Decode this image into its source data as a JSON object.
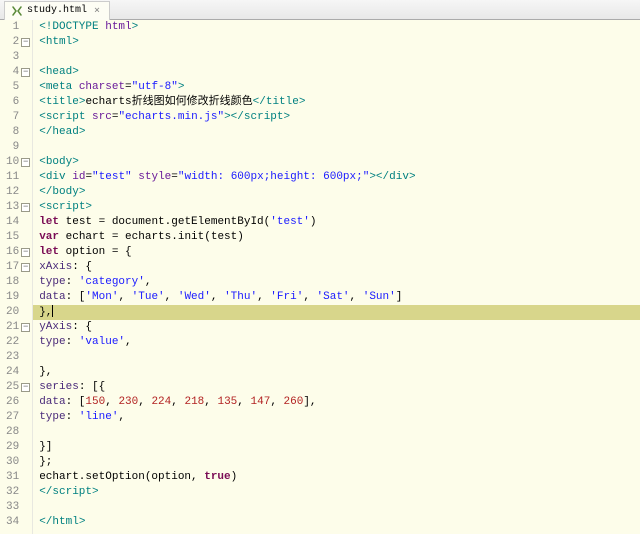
{
  "tab": {
    "filename": "study.html",
    "icon_label": "html",
    "close_glyph": "⨯"
  },
  "fold_glyph": "−",
  "lines": [
    {
      "num": 1,
      "foldable": false,
      "highlighted": false,
      "tokens": [
        [
          "t-punct",
          "<!"
        ],
        [
          "t-tag",
          "DOCTYPE"
        ],
        [
          "t-text",
          " "
        ],
        [
          "t-attr",
          "html"
        ],
        [
          "t-punct",
          ">"
        ]
      ]
    },
    {
      "num": 2,
      "foldable": true,
      "highlighted": false,
      "tokens": [
        [
          "t-punct",
          "<"
        ],
        [
          "t-tag",
          "html"
        ],
        [
          "t-punct",
          ">"
        ]
      ]
    },
    {
      "num": 3,
      "foldable": false,
      "highlighted": false,
      "tokens": []
    },
    {
      "num": 4,
      "foldable": true,
      "highlighted": false,
      "tokens": [
        [
          "t-text",
          "    "
        ],
        [
          "t-punct",
          "<"
        ],
        [
          "t-tag",
          "head"
        ],
        [
          "t-punct",
          ">"
        ]
      ]
    },
    {
      "num": 5,
      "foldable": false,
      "highlighted": false,
      "tokens": [
        [
          "t-text",
          "        "
        ],
        [
          "t-punct",
          "<"
        ],
        [
          "t-tag",
          "meta"
        ],
        [
          "t-text",
          " "
        ],
        [
          "t-attr",
          "charset"
        ],
        [
          "t-op",
          "="
        ],
        [
          "t-string",
          "\"utf-8\""
        ],
        [
          "t-punct",
          ">"
        ]
      ]
    },
    {
      "num": 6,
      "foldable": false,
      "highlighted": false,
      "tokens": [
        [
          "t-text",
          "        "
        ],
        [
          "t-punct",
          "<"
        ],
        [
          "t-tag",
          "title"
        ],
        [
          "t-punct",
          ">"
        ],
        [
          "t-text",
          "echarts折线图如何修改折线颜色"
        ],
        [
          "t-punct",
          "</"
        ],
        [
          "t-tag",
          "title"
        ],
        [
          "t-punct",
          ">"
        ]
      ]
    },
    {
      "num": 7,
      "foldable": false,
      "highlighted": false,
      "tokens": [
        [
          "t-text",
          "        "
        ],
        [
          "t-punct",
          "<"
        ],
        [
          "t-tag",
          "script"
        ],
        [
          "t-text",
          " "
        ],
        [
          "t-attr",
          "src"
        ],
        [
          "t-op",
          "="
        ],
        [
          "t-string",
          "\"echarts.min.js\""
        ],
        [
          "t-punct",
          "></"
        ],
        [
          "t-tag",
          "script"
        ],
        [
          "t-punct",
          ">"
        ]
      ]
    },
    {
      "num": 8,
      "foldable": false,
      "highlighted": false,
      "tokens": [
        [
          "t-text",
          "    "
        ],
        [
          "t-punct",
          "</"
        ],
        [
          "t-tag",
          "head"
        ],
        [
          "t-punct",
          ">"
        ]
      ]
    },
    {
      "num": 9,
      "foldable": false,
      "highlighted": false,
      "tokens": []
    },
    {
      "num": 10,
      "foldable": true,
      "highlighted": false,
      "tokens": [
        [
          "t-text",
          "    "
        ],
        [
          "t-punct",
          "<"
        ],
        [
          "t-tag",
          "body"
        ],
        [
          "t-punct",
          ">"
        ]
      ]
    },
    {
      "num": 11,
      "foldable": false,
      "highlighted": false,
      "tokens": [
        [
          "t-text",
          "        "
        ],
        [
          "t-punct",
          "<"
        ],
        [
          "t-tag",
          "div"
        ],
        [
          "t-text",
          " "
        ],
        [
          "t-attr",
          "id"
        ],
        [
          "t-op",
          "="
        ],
        [
          "t-string",
          "\"test\""
        ],
        [
          "t-text",
          "  "
        ],
        [
          "t-attr",
          "style"
        ],
        [
          "t-op",
          "="
        ],
        [
          "t-string",
          "\"width: 600px;height: 600px;\""
        ],
        [
          "t-punct",
          "></"
        ],
        [
          "t-tag",
          "div"
        ],
        [
          "t-punct",
          ">"
        ]
      ]
    },
    {
      "num": 12,
      "foldable": false,
      "highlighted": false,
      "tokens": [
        [
          "t-text",
          "    "
        ],
        [
          "t-punct",
          "</"
        ],
        [
          "t-tag",
          "body"
        ],
        [
          "t-punct",
          ">"
        ]
      ]
    },
    {
      "num": 13,
      "foldable": true,
      "highlighted": false,
      "tokens": [
        [
          "t-text",
          "    "
        ],
        [
          "t-punct",
          "<"
        ],
        [
          "t-tag",
          "script"
        ],
        [
          "t-punct",
          ">"
        ]
      ]
    },
    {
      "num": 14,
      "foldable": false,
      "highlighted": false,
      "tokens": [
        [
          "t-text",
          "        "
        ],
        [
          "t-keyword",
          "let"
        ],
        [
          "t-text",
          " test "
        ],
        [
          "t-op",
          "="
        ],
        [
          "t-text",
          " document.getElementById("
        ],
        [
          "t-string",
          "'test'"
        ],
        [
          "t-text",
          ")"
        ]
      ]
    },
    {
      "num": 15,
      "foldable": false,
      "highlighted": false,
      "tokens": [
        [
          "t-text",
          "        "
        ],
        [
          "t-keyword",
          "var"
        ],
        [
          "t-text",
          " echart "
        ],
        [
          "t-op",
          "="
        ],
        [
          "t-text",
          " echarts.init(test)"
        ]
      ]
    },
    {
      "num": 16,
      "foldable": true,
      "highlighted": false,
      "tokens": [
        [
          "t-text",
          "        "
        ],
        [
          "t-keyword",
          "let"
        ],
        [
          "t-text",
          " option "
        ],
        [
          "t-op",
          "="
        ],
        [
          "t-text",
          " {"
        ]
      ]
    },
    {
      "num": 17,
      "foldable": true,
      "highlighted": false,
      "tokens": [
        [
          "t-text",
          "            "
        ],
        [
          "t-prop",
          "xAxis"
        ],
        [
          "t-text",
          ": {"
        ]
      ]
    },
    {
      "num": 18,
      "foldable": false,
      "highlighted": false,
      "tokens": [
        [
          "t-text",
          "                "
        ],
        [
          "t-prop",
          "type"
        ],
        [
          "t-text",
          ": "
        ],
        [
          "t-string",
          "'category'"
        ],
        [
          "t-text",
          ","
        ]
      ]
    },
    {
      "num": 19,
      "foldable": false,
      "highlighted": false,
      "tokens": [
        [
          "t-text",
          "                "
        ],
        [
          "t-prop",
          "data"
        ],
        [
          "t-text",
          ": ["
        ],
        [
          "t-string",
          "'Mon'"
        ],
        [
          "t-text",
          ", "
        ],
        [
          "t-string",
          "'Tue'"
        ],
        [
          "t-text",
          ", "
        ],
        [
          "t-string",
          "'Wed'"
        ],
        [
          "t-text",
          ", "
        ],
        [
          "t-string",
          "'Thu'"
        ],
        [
          "t-text",
          ", "
        ],
        [
          "t-string",
          "'Fri'"
        ],
        [
          "t-text",
          ", "
        ],
        [
          "t-string",
          "'Sat'"
        ],
        [
          "t-text",
          ", "
        ],
        [
          "t-string",
          "'Sun'"
        ],
        [
          "t-text",
          "]"
        ]
      ]
    },
    {
      "num": 20,
      "foldable": false,
      "highlighted": true,
      "tokens": [
        [
          "t-text",
          "            },"
        ],
        [
          "cursor",
          ""
        ]
      ]
    },
    {
      "num": 21,
      "foldable": true,
      "highlighted": false,
      "tokens": [
        [
          "t-text",
          "            "
        ],
        [
          "t-prop",
          "yAxis"
        ],
        [
          "t-text",
          ": {"
        ]
      ]
    },
    {
      "num": 22,
      "foldable": false,
      "highlighted": false,
      "tokens": [
        [
          "t-text",
          "                "
        ],
        [
          "t-prop",
          "type"
        ],
        [
          "t-text",
          ": "
        ],
        [
          "t-string",
          "'value'"
        ],
        [
          "t-text",
          ","
        ]
      ]
    },
    {
      "num": 23,
      "foldable": false,
      "highlighted": false,
      "tokens": []
    },
    {
      "num": 24,
      "foldable": false,
      "highlighted": false,
      "tokens": [
        [
          "t-text",
          "            },"
        ]
      ]
    },
    {
      "num": 25,
      "foldable": true,
      "highlighted": false,
      "tokens": [
        [
          "t-text",
          "            "
        ],
        [
          "t-prop",
          "series"
        ],
        [
          "t-text",
          ": [{"
        ]
      ]
    },
    {
      "num": 26,
      "foldable": false,
      "highlighted": false,
      "tokens": [
        [
          "t-text",
          "                "
        ],
        [
          "t-prop",
          "data"
        ],
        [
          "t-text",
          ": ["
        ],
        [
          "t-num",
          "150"
        ],
        [
          "t-text",
          ", "
        ],
        [
          "t-num",
          "230"
        ],
        [
          "t-text",
          ", "
        ],
        [
          "t-num",
          "224"
        ],
        [
          "t-text",
          ", "
        ],
        [
          "t-num",
          "218"
        ],
        [
          "t-text",
          ", "
        ],
        [
          "t-num",
          "135"
        ],
        [
          "t-text",
          ", "
        ],
        [
          "t-num",
          "147"
        ],
        [
          "t-text",
          ", "
        ],
        [
          "t-num",
          "260"
        ],
        [
          "t-text",
          "],"
        ]
      ]
    },
    {
      "num": 27,
      "foldable": false,
      "highlighted": false,
      "tokens": [
        [
          "t-text",
          "                "
        ],
        [
          "t-prop",
          "type"
        ],
        [
          "t-text",
          ": "
        ],
        [
          "t-string",
          "'line'"
        ],
        [
          "t-text",
          ","
        ]
      ]
    },
    {
      "num": 28,
      "foldable": false,
      "highlighted": false,
      "tokens": []
    },
    {
      "num": 29,
      "foldable": false,
      "highlighted": false,
      "tokens": [
        [
          "t-text",
          "            }]"
        ]
      ]
    },
    {
      "num": 30,
      "foldable": false,
      "highlighted": false,
      "tokens": [
        [
          "t-text",
          "        };"
        ]
      ]
    },
    {
      "num": 31,
      "foldable": false,
      "highlighted": false,
      "tokens": [
        [
          "t-text",
          "        echart.setOption(option, "
        ],
        [
          "t-keyword",
          "true"
        ],
        [
          "t-text",
          ")"
        ]
      ]
    },
    {
      "num": 32,
      "foldable": false,
      "highlighted": false,
      "tokens": [
        [
          "t-text",
          "    "
        ],
        [
          "t-punct",
          "</"
        ],
        [
          "t-tag",
          "script"
        ],
        [
          "t-punct",
          ">"
        ]
      ]
    },
    {
      "num": 33,
      "foldable": false,
      "highlighted": false,
      "tokens": []
    },
    {
      "num": 34,
      "foldable": false,
      "highlighted": false,
      "tokens": [
        [
          "t-text",
          " "
        ],
        [
          "t-punct",
          "</"
        ],
        [
          "t-tag",
          "html"
        ],
        [
          "t-punct",
          ">"
        ]
      ]
    }
  ]
}
